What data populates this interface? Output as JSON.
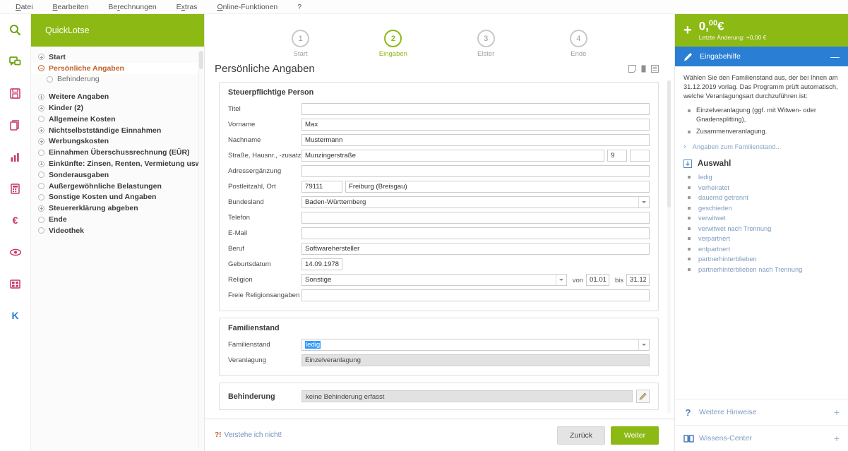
{
  "menubar": {
    "items": [
      {
        "label": "Datei",
        "acc": "D"
      },
      {
        "label": "Bearbeiten",
        "acc": "B"
      },
      {
        "label": "Berechnungen",
        "acc": "r"
      },
      {
        "label": "Extras",
        "acc": "x"
      },
      {
        "label": "Online-Funktionen",
        "acc": "O"
      },
      {
        "label": "?",
        "acc": ""
      }
    ]
  },
  "rail": {
    "items": [
      {
        "name": "search-icon",
        "color": "#6aa30f"
      },
      {
        "name": "chat-icon",
        "color": "#6aa30f"
      },
      {
        "name": "save-icon",
        "color": "#c43a6a"
      },
      {
        "name": "copy-icon",
        "color": "#c43a6a"
      },
      {
        "name": "bar-chart-icon",
        "color": "#c43a6a"
      },
      {
        "name": "calculator-icon",
        "color": "#c43a6a"
      },
      {
        "name": "euro-icon",
        "color": "#c43a6a"
      },
      {
        "name": "eye-icon",
        "color": "#c43a6a"
      },
      {
        "name": "grid-icon",
        "color": "#c43a6a"
      },
      {
        "name": "k-icon",
        "color": "#2a7fd4",
        "text": "K"
      }
    ]
  },
  "sidebar": {
    "title": "QuickLotse",
    "items": [
      {
        "label": "Start",
        "level": 1,
        "marker": "plus",
        "active": false,
        "gap": false
      },
      {
        "label": "Persönliche Angaben",
        "level": 1,
        "marker": "minus",
        "active": true,
        "gap": false
      },
      {
        "label": "Behinderung",
        "level": 2,
        "marker": "circle",
        "active": false,
        "gap": false
      },
      {
        "label": "Weitere Angaben",
        "level": 1,
        "marker": "plus",
        "active": false,
        "gap": true
      },
      {
        "label": "Kinder (2)",
        "level": 1,
        "marker": "plus",
        "active": false,
        "gap": false
      },
      {
        "label": "Allgemeine Kosten",
        "level": 1,
        "marker": "circle",
        "active": false,
        "gap": false
      },
      {
        "label": "Nichtselbstständige Einnahmen",
        "level": 1,
        "marker": "plus",
        "active": false,
        "gap": false
      },
      {
        "label": "Werbungskosten",
        "level": 1,
        "marker": "plus",
        "active": false,
        "gap": false
      },
      {
        "label": "Einnahmen Überschussrechnung (EÜR)",
        "level": 1,
        "marker": "circle",
        "active": false,
        "gap": false
      },
      {
        "label": "Einkünfte: Zinsen, Renten, Vermietung usw.",
        "level": 1,
        "marker": "plus",
        "active": false,
        "gap": false
      },
      {
        "label": "Sonderausgaben",
        "level": 1,
        "marker": "circle",
        "active": false,
        "gap": false
      },
      {
        "label": "Außergewöhnliche Belastungen",
        "level": 1,
        "marker": "circle",
        "active": false,
        "gap": false
      },
      {
        "label": "Sonstige Kosten und Angaben",
        "level": 1,
        "marker": "circle",
        "active": false,
        "gap": false
      },
      {
        "label": "Steuererklärung abgeben",
        "level": 1,
        "marker": "plus",
        "active": false,
        "gap": false
      },
      {
        "label": "Ende",
        "level": 1,
        "marker": "circle",
        "active": false,
        "gap": false
      },
      {
        "label": "Videothek",
        "level": 1,
        "marker": "circle",
        "active": false,
        "gap": false
      }
    ]
  },
  "stepper": {
    "steps": [
      {
        "number": "1",
        "label": "Start",
        "active": false
      },
      {
        "number": "2",
        "label": "Eingaben",
        "active": true
      },
      {
        "number": "3",
        "label": "Elster",
        "active": false
      },
      {
        "number": "4",
        "label": "Ende",
        "active": false
      }
    ]
  },
  "page": {
    "title": "Persönliche Angaben",
    "title_icons": [
      "note-icon",
      "bookmark-icon",
      "list-icon"
    ]
  },
  "form": {
    "person_panel": {
      "title": "Steuerpflichtige Person",
      "fields": [
        {
          "label": "Titel",
          "value": "",
          "type": "text"
        },
        {
          "label": "Vorname",
          "value": "Max",
          "type": "text"
        },
        {
          "label": "Nachname",
          "value": "Mustermann",
          "type": "text"
        },
        {
          "label": "Straße, Hausnr., -zusatz",
          "value": "Munzingerstraße",
          "housenr": "9",
          "suffix": "",
          "type": "street"
        },
        {
          "label": "Adressergänzung",
          "value": "",
          "type": "text"
        },
        {
          "label": "Postleitzahl, Ort",
          "value": "79111",
          "city": "Freiburg (Breisgau)",
          "type": "plz"
        },
        {
          "label": "Bundesland",
          "value": "Baden-Württemberg",
          "type": "select"
        },
        {
          "label": "Telefon",
          "value": "",
          "type": "text"
        },
        {
          "label": "E-Mail",
          "value": "",
          "type": "text"
        },
        {
          "label": "Beruf",
          "value": "Softwarehersteller",
          "type": "text"
        },
        {
          "label": "Geburtsdatum",
          "value": "14.09.1978",
          "type": "date"
        },
        {
          "label": "Religion",
          "value": "Sonstige",
          "type": "religion",
          "von_label": "von",
          "von": "01.01",
          "bis_label": "bis",
          "bis": "31.12"
        },
        {
          "label": "Freie Religionsangaben",
          "value": "",
          "type": "text"
        }
      ]
    },
    "family_panel": {
      "title": "Familienstand",
      "status_label": "Familienstand",
      "status_value": "ledig",
      "assessment_label": "Veranlagung",
      "assessment_value": "Einzelveranlagung"
    },
    "disability_panel": {
      "title": "Behinderung",
      "value": "keine Behinderung erfasst",
      "edit_icon": "pencil-icon"
    }
  },
  "bottom": {
    "help_prefix": "?!",
    "help_label": "Verstehe ich nicht!",
    "back_label": "Zurück",
    "next_label": "Weiter"
  },
  "rightpane": {
    "refund": {
      "plus": "+",
      "amount_main": "0,",
      "amount_cents": "00",
      "currency": "€",
      "sub": "Letzte Änderung: +0,00 €"
    },
    "help_header": {
      "title": "Eingabehilfe",
      "minimize": "—"
    },
    "help_text": "Wählen Sie den Familienstand aus, der bei Ihnen am 31.12.2019 vorlag. Das Programm prüft automatisch, welche Veranlagungsart durchzuführen ist:",
    "help_bullets": [
      "Einzelveranlagung (ggf. mit Witwen- oder Gnadensplitting),",
      "Zusammenveranlagung."
    ],
    "detail_link": "Angaben zum Familienstand...",
    "selection_title": "Auswahl",
    "options": [
      "ledig",
      "verheiratet",
      "dauernd getrennt",
      "geschieden",
      "verwitwet",
      "verwitwet nach Trennung",
      "verpartnert",
      "entpartnert",
      "partnerhinterblieben",
      "partnerhinterblieben nach Trennung"
    ],
    "footer_items": [
      {
        "label": "Weitere Hinweise",
        "icon": "question-icon",
        "expand": "+"
      },
      {
        "label": "Wissens-Center",
        "icon": "book-icon",
        "expand": "+"
      }
    ]
  },
  "colors": {
    "brand_green": "#8cb914",
    "accent_blue": "#2a7fd4",
    "active_orange": "#c0622a",
    "link_blue": "#7e9cc0"
  }
}
